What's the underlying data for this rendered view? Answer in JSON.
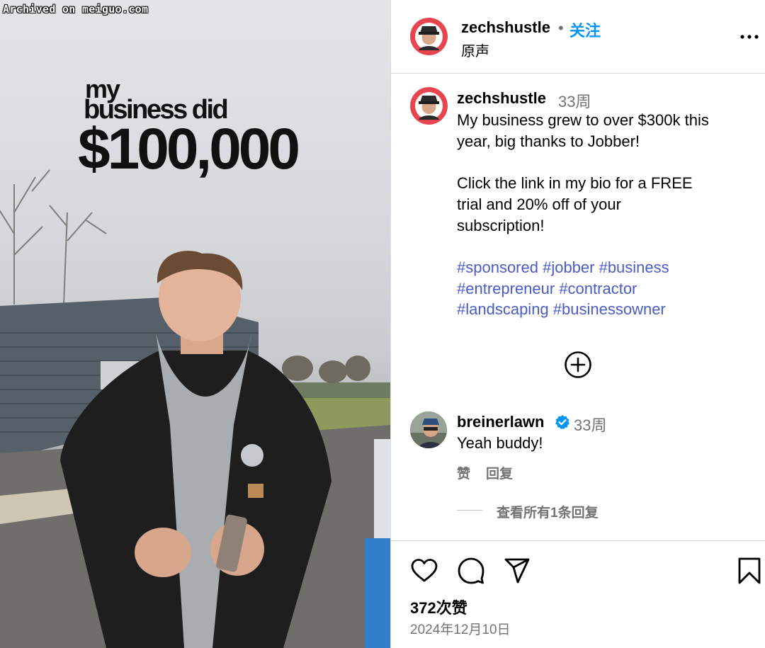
{
  "media": {
    "watermark": "Archived on meiguo.com",
    "overlay_line1": "my",
    "overlay_line2": "business did",
    "overlay_line3": "$100,000"
  },
  "header": {
    "username": "zechshustle",
    "separator": "•",
    "follow_label": "关注",
    "audio_label": "原声",
    "more_icon": "more-horizontal-icon"
  },
  "caption": {
    "username": "zechshustle",
    "time": "33周",
    "text_lines": [
      "My business grew to over $300k this",
      "year, big thanks to Jobber!",
      "",
      "Click the link in my bio for a FREE",
      "trial and 20% off of your",
      "subscription!",
      ""
    ],
    "hashtag_lines": [
      "#sponsored #jobber #business",
      "#entrepreneur #contractor",
      "#landscaping #businessowner"
    ]
  },
  "load_more_icon": "plus-circle-icon",
  "comment": {
    "username": "breinerlawn",
    "verified_icon": "verified-badge-icon",
    "time": "33周",
    "text": "Yeah buddy!",
    "like_label": "赞",
    "reply_label": "回复",
    "view_replies_label": "查看所有1条回复"
  },
  "actions": {
    "icons": [
      "heart-icon",
      "comment-icon",
      "share-icon",
      "bookmark-icon"
    ],
    "likes": "372次赞",
    "date": "2024年12月10日"
  },
  "colors": {
    "follow_blue": "#0095f6",
    "hashtag": "#4a5bc8",
    "secondary_text": "#737373",
    "divider": "#dbdbdb",
    "avatar_red": "#e8454f"
  }
}
